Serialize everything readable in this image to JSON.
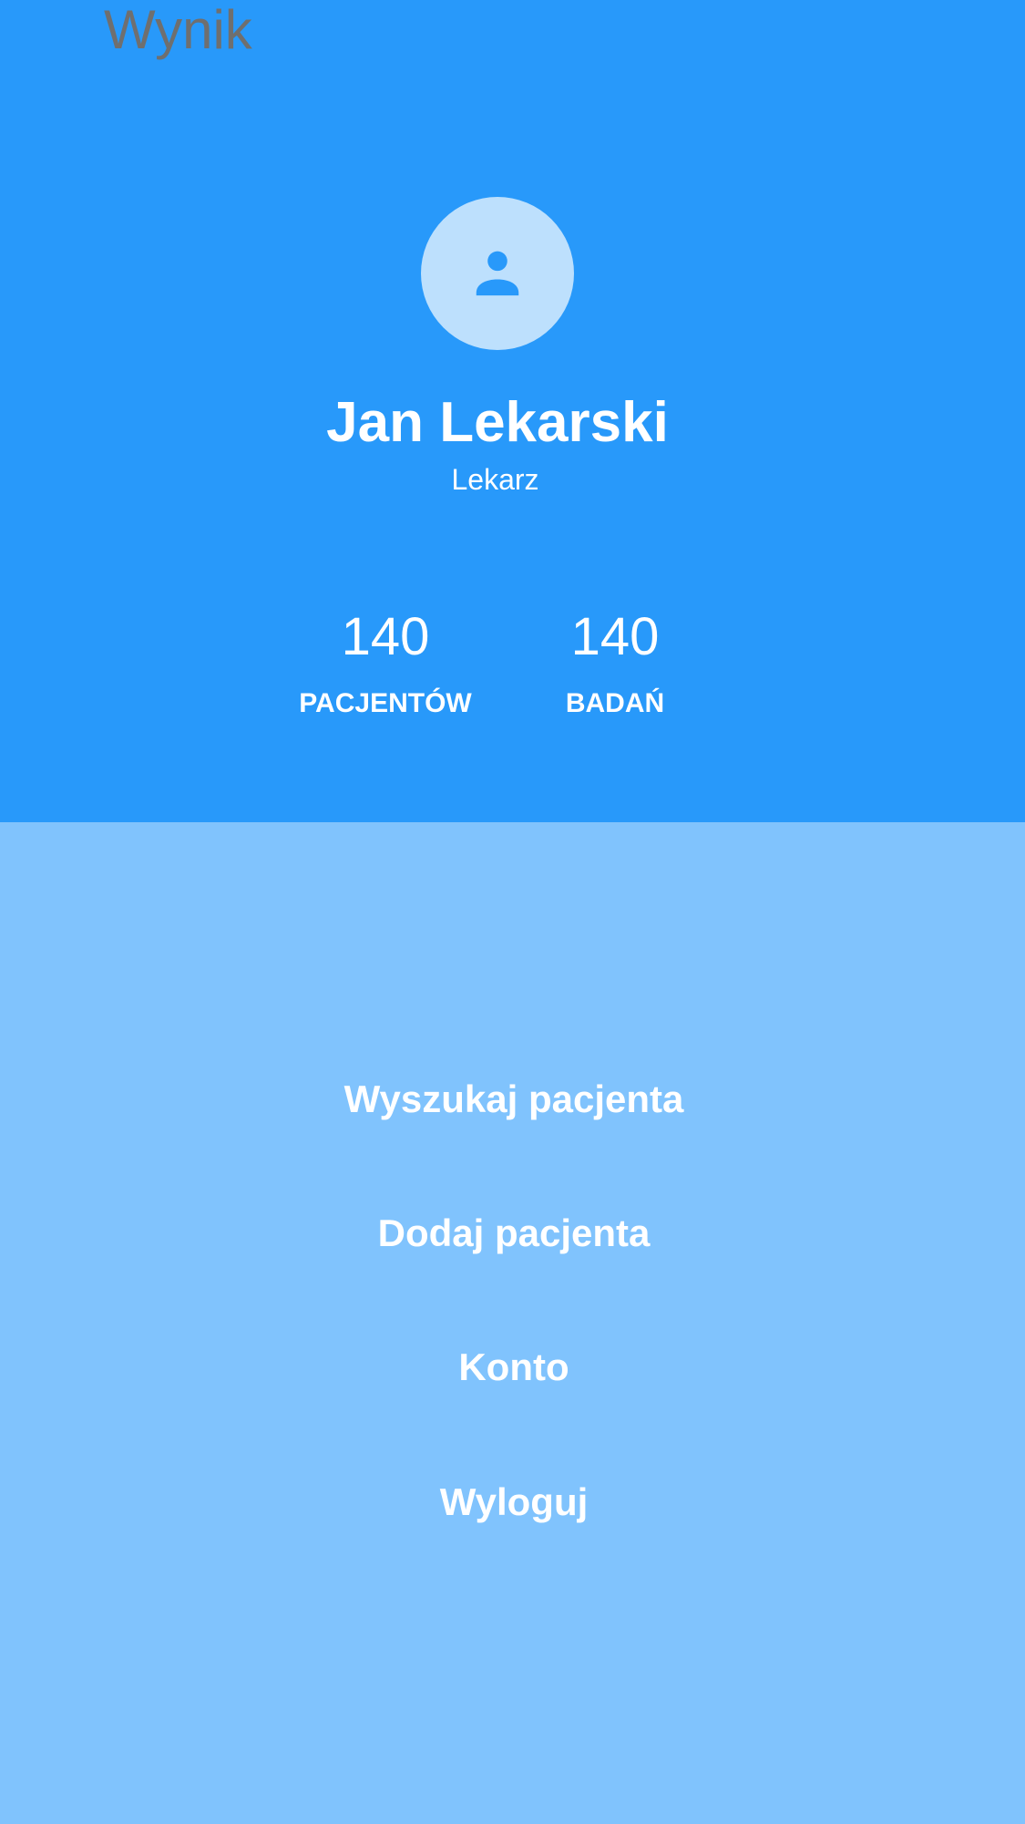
{
  "header": {
    "app_title": "Wynik",
    "avatar_icon": "person-icon",
    "user_name": "Jan Lekarski",
    "user_role": "Lekarz",
    "stats": [
      {
        "value": "140",
        "label": "PACJENTÓW"
      },
      {
        "value": "140",
        "label": "BADAŃ"
      }
    ]
  },
  "menu": {
    "items": [
      {
        "label": "Wyszukaj pacjenta"
      },
      {
        "label": "Dodaj pacjenta"
      },
      {
        "label": "Konto"
      },
      {
        "label": "Wyloguj"
      }
    ]
  },
  "colors": {
    "header_bg": "#2899fa",
    "menu_bg": "#80c3fd",
    "avatar_bg": "#bde0fd",
    "title_text": "#6f6f6f",
    "primary_text": "#ffffff"
  }
}
